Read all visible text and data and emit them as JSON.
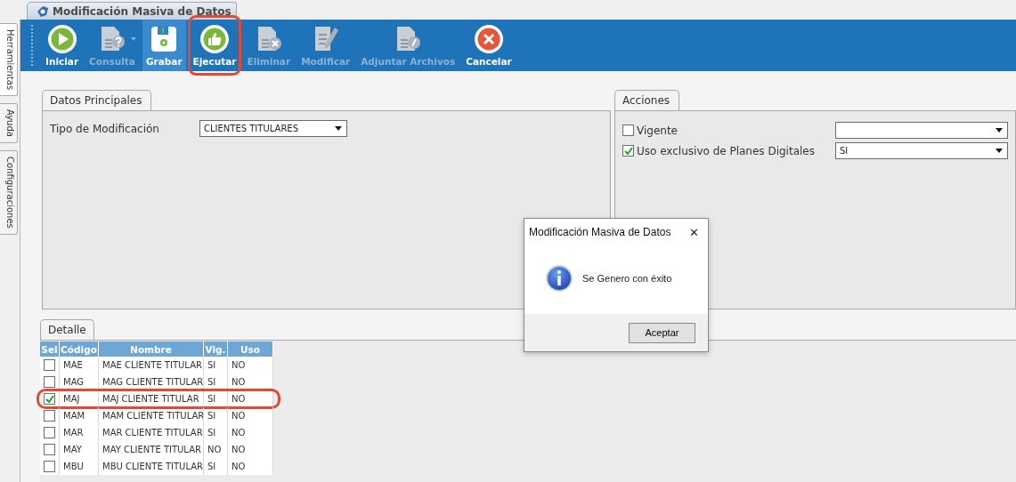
{
  "window": {
    "title": "Modificación Masiva de Datos"
  },
  "side_tabs": [
    {
      "label": "Herramientas",
      "selected": true
    },
    {
      "label": "Ayuda",
      "selected": false
    },
    {
      "label": "Configuraciones",
      "selected": false
    }
  ],
  "toolbar": [
    {
      "label": "Iniciar",
      "kind": "play",
      "disabled": false,
      "pressed": false,
      "highlighted": false,
      "dropdown": false
    },
    {
      "label": "Consulta",
      "kind": "query",
      "disabled": true,
      "pressed": false,
      "highlighted": false,
      "dropdown": true
    },
    {
      "label": "Grabar",
      "kind": "save",
      "disabled": false,
      "pressed": true,
      "highlighted": false,
      "dropdown": false
    },
    {
      "label": "Ejecutar",
      "kind": "thumb",
      "disabled": false,
      "pressed": false,
      "highlighted": true,
      "dropdown": false
    },
    {
      "label": "Eliminar",
      "kind": "delete",
      "disabled": true,
      "pressed": false,
      "highlighted": false,
      "dropdown": false
    },
    {
      "label": "Modificar",
      "kind": "edit",
      "disabled": true,
      "pressed": false,
      "highlighted": false,
      "dropdown": false
    },
    {
      "label": "Adjuntar Archivos",
      "kind": "attach",
      "disabled": true,
      "pressed": false,
      "highlighted": false,
      "dropdown": false
    },
    {
      "label": "Cancelar",
      "kind": "cancel",
      "disabled": false,
      "pressed": false,
      "highlighted": false,
      "dropdown": false
    }
  ],
  "datos_principales": {
    "tab": "Datos Principales",
    "field_label": "Tipo de Modificación",
    "field_value": "CLIENTES TITULARES"
  },
  "acciones": {
    "tab": "Acciones",
    "rows": [
      {
        "label": "Vigente",
        "checked": false,
        "value": ""
      },
      {
        "label": "Uso exclusivo de Planes Digitales",
        "checked": true,
        "value": "SI"
      }
    ]
  },
  "detalle": {
    "tab": "Detalle",
    "selection_header": "Sel",
    "columns": [
      "Código",
      "Nombre",
      "Vig.",
      "Uso"
    ],
    "rows": [
      {
        "selected": false,
        "highlighted": false,
        "cells": [
          "MAE",
          "MAE CLIENTE TITULAR",
          "SI",
          "NO"
        ]
      },
      {
        "selected": false,
        "highlighted": false,
        "cells": [
          "MAG",
          "MAG CLIENTE TITULAR",
          "SI",
          "NO"
        ]
      },
      {
        "selected": true,
        "highlighted": true,
        "cells": [
          "MAJ",
          "MAJ CLIENTE TITULAR",
          "SI",
          "NO"
        ]
      },
      {
        "selected": false,
        "highlighted": false,
        "cells": [
          "MAM",
          "MAM CLIENTE TITULAR",
          "SI",
          "NO"
        ]
      },
      {
        "selected": false,
        "highlighted": false,
        "cells": [
          "MAR",
          "MAR CLIENTE TITULAR",
          "SI",
          "NO"
        ]
      },
      {
        "selected": false,
        "highlighted": false,
        "cells": [
          "MAY",
          "MAY CLIENTE TITULAR",
          "NO",
          "NO"
        ]
      },
      {
        "selected": false,
        "highlighted": false,
        "cells": [
          "MBU",
          "MBU CLIENTE TITULAR",
          "SI",
          "NO"
        ]
      }
    ]
  },
  "dialog": {
    "title": "Modificación Masiva de Datos",
    "close": "✕",
    "message": "Se Genero con éxito",
    "button": "Aceptar"
  }
}
